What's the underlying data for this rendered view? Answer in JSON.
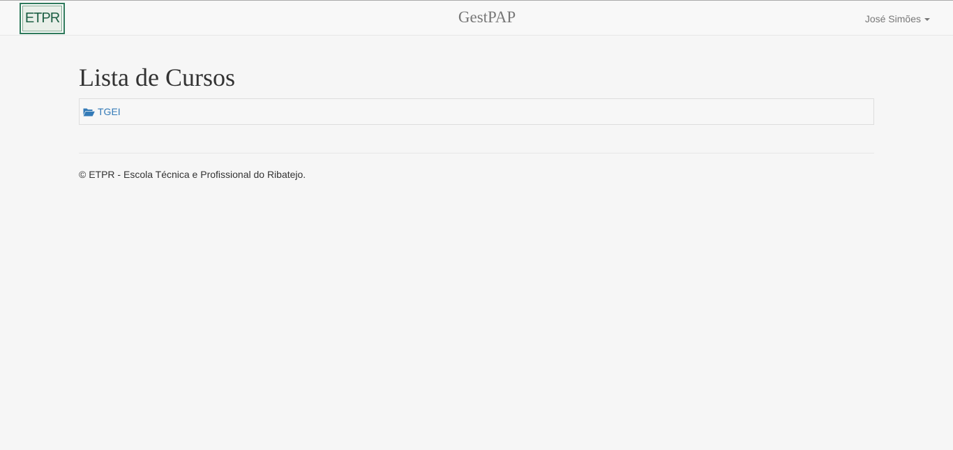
{
  "navbar": {
    "logo": {
      "text": "ETPR",
      "color": "#1d5f44",
      "border_color": "#2f7a5c"
    },
    "brand": "GestPAP",
    "user": {
      "name": "José Simões",
      "icon": "caret-down-icon"
    }
  },
  "main": {
    "title": "Lista de Cursos",
    "courses": [
      {
        "label": "TGEI",
        "icon": "folder-open-icon",
        "color": "#337ab7"
      }
    ]
  },
  "footer": {
    "text": "© ETPR - Escola Técnica e Profissional do Ribatejo."
  }
}
